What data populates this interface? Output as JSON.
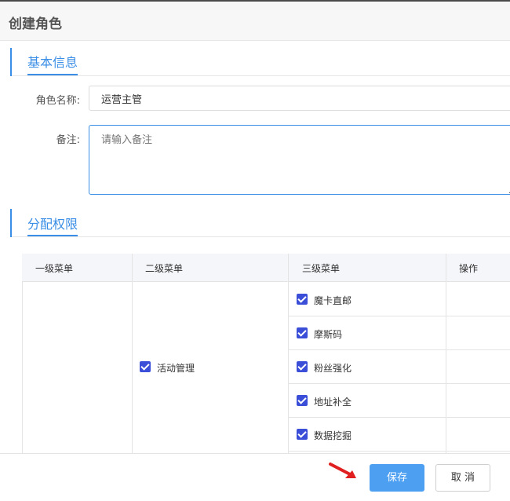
{
  "dialog": {
    "title": "创建角色"
  },
  "basic_info": {
    "heading": "基本信息",
    "role_name_label": "角色名称:",
    "role_name_value": "运营主管",
    "remark_label": "备注:",
    "remark_placeholder": "请输入备注"
  },
  "permissions": {
    "heading": "分配权限",
    "columns": [
      "一级菜单",
      "二级菜单",
      "三级菜单",
      "操作"
    ],
    "level2": {
      "label": "活动管理",
      "checked": true
    },
    "level3": [
      {
        "label": "魔卡直邮",
        "checked": true
      },
      {
        "label": "摩斯码",
        "checked": true
      },
      {
        "label": "粉丝强化",
        "checked": true
      },
      {
        "label": "地址补全",
        "checked": true
      },
      {
        "label": "数据挖掘",
        "checked": true
      }
    ]
  },
  "footer": {
    "save_label": "保存",
    "cancel_label": "取 消"
  },
  "colors": {
    "accent": "#3a8ee6",
    "checkbox": "#3a4ed8",
    "save_button": "#4d9ff2",
    "arrow": "#e02020"
  },
  "icons": {
    "annotation_arrow": "red-arrow-icon",
    "checkbox": "checkbox-checked-icon"
  }
}
